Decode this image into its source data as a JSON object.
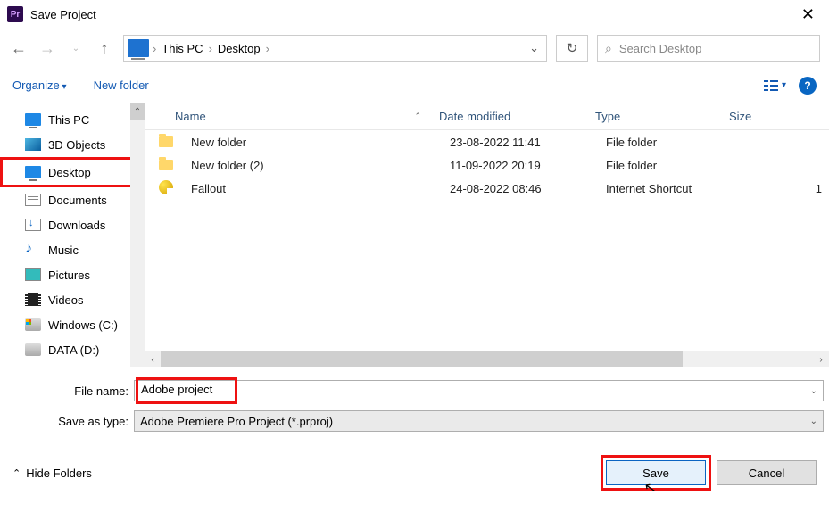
{
  "title": "Save Project",
  "breadcrumbs": [
    "This PC",
    "Desktop"
  ],
  "search_placeholder": "Search Desktop",
  "toolbar": {
    "organize": "Organize",
    "newfolder": "New folder"
  },
  "help_label": "?",
  "tree": [
    {
      "label": "This PC",
      "icon": "monitor"
    },
    {
      "label": "3D Objects",
      "icon": "cube"
    },
    {
      "label": "Desktop",
      "icon": "monitor",
      "highlight": true
    },
    {
      "label": "Documents",
      "icon": "doc"
    },
    {
      "label": "Downloads",
      "icon": "down"
    },
    {
      "label": "Music",
      "icon": "music"
    },
    {
      "label": "Pictures",
      "icon": "pic"
    },
    {
      "label": "Videos",
      "icon": "vid"
    },
    {
      "label": "Windows (C:)",
      "icon": "drivewin"
    },
    {
      "label": "DATA (D:)",
      "icon": "drive"
    }
  ],
  "columns": {
    "name": "Name",
    "date": "Date modified",
    "type": "Type",
    "size": "Size"
  },
  "rows": [
    {
      "icon": "folder",
      "name": "New folder",
      "date": "23-08-2022 11:41",
      "type": "File folder",
      "size": ""
    },
    {
      "icon": "folder",
      "name": "New folder (2)",
      "date": "11-09-2022 20:19",
      "type": "File folder",
      "size": ""
    },
    {
      "icon": "link",
      "name": "Fallout",
      "date": "24-08-2022 08:46",
      "type": "Internet Shortcut",
      "size": "1"
    }
  ],
  "form": {
    "filename_label": "File name:",
    "filename_value": "Adobe project",
    "saveas_label": "Save as type:",
    "saveas_value": "Adobe Premiere Pro Project (*.prproj)"
  },
  "footer": {
    "hide": "Hide Folders",
    "save": "Save",
    "cancel": "Cancel"
  }
}
